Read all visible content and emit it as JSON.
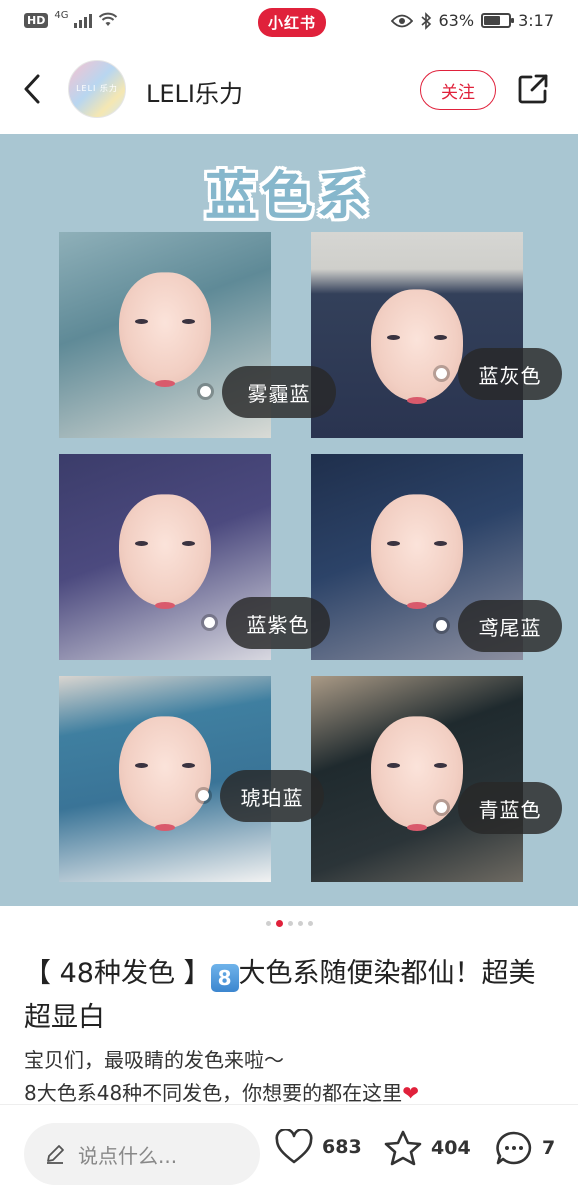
{
  "status_bar": {
    "hd": "HD",
    "network": "4G",
    "app_badge": "小红书",
    "battery_percent": "63%",
    "battery_level": 0.63,
    "time": "3:17"
  },
  "header": {
    "account_name": "LELI乐力",
    "avatar_text": "LELI 乐力",
    "follow_label": "关注"
  },
  "image": {
    "title": "蓝色系",
    "background_color": "#a9c6d2",
    "tags": [
      {
        "label": "雾霾蓝"
      },
      {
        "label": "蓝灰色"
      },
      {
        "label": "蓝紫色"
      },
      {
        "label": "鸢尾蓝"
      },
      {
        "label": "琥珀蓝"
      },
      {
        "label": "青蓝色"
      }
    ],
    "pager": {
      "total": 5,
      "active": 1
    }
  },
  "post": {
    "title_prefix": "【 48种发色 】",
    "title_badge": "8",
    "title_suffix": "大色系随便染都仙！超美超显白",
    "body_line1": "宝贝们，最吸睛的发色来啦～",
    "body_line2": "8大色系48种不同发色，你想要的都在这里",
    "body_heart": "❤"
  },
  "bottom_bar": {
    "comment_placeholder": "说点什么...",
    "likes": "683",
    "collects": "404",
    "comments": "7"
  },
  "colors": {
    "accent": "#e0213b",
    "image_bg": "#a9c6d2",
    "title_blue": "#86b7cc",
    "tag_bg": "#2e2e2e"
  },
  "icons": {
    "back": "back-arrow-icon",
    "share": "share-icon",
    "edit": "pencil-icon",
    "like": "heart-icon",
    "collect": "star-icon",
    "comment": "comment-bubble-icon"
  }
}
